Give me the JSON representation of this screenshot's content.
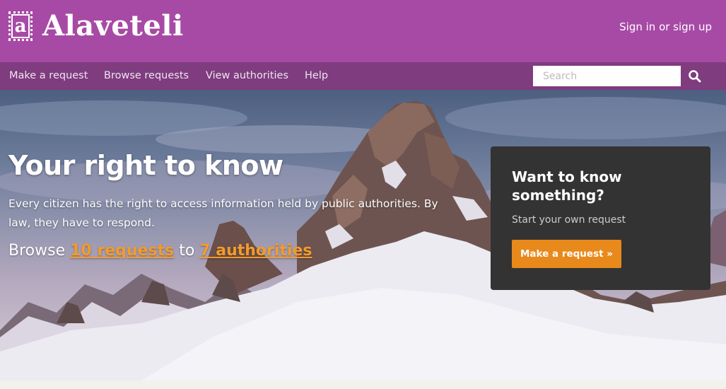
{
  "header": {
    "logo_letter": "a",
    "site_name": "Alaveteli",
    "signin_label": "Sign in or sign up"
  },
  "nav": {
    "items": [
      {
        "label": "Make a request"
      },
      {
        "label": "Browse requests"
      },
      {
        "label": "View authorities"
      },
      {
        "label": "Help"
      }
    ],
    "search_placeholder": "Search",
    "search_icon": "search-icon"
  },
  "hero": {
    "title": "Your right to know",
    "description": "Every citizen has the right to access information held by public authorities. By law, they have to respond.",
    "browse_prefix": "Browse ",
    "requests_link": "10 requests",
    "browse_middle": " to ",
    "authorities_link": "7 authorities"
  },
  "cta": {
    "title": "Want to know something?",
    "subtitle": "Start your own request",
    "button_label": "Make a request »"
  },
  "colors": {
    "header_bg": "#a74aa5",
    "nav_bg": "#7f3c7f",
    "accent": "#e8891c",
    "link": "#f39b2c",
    "cta_bg": "#333333"
  }
}
